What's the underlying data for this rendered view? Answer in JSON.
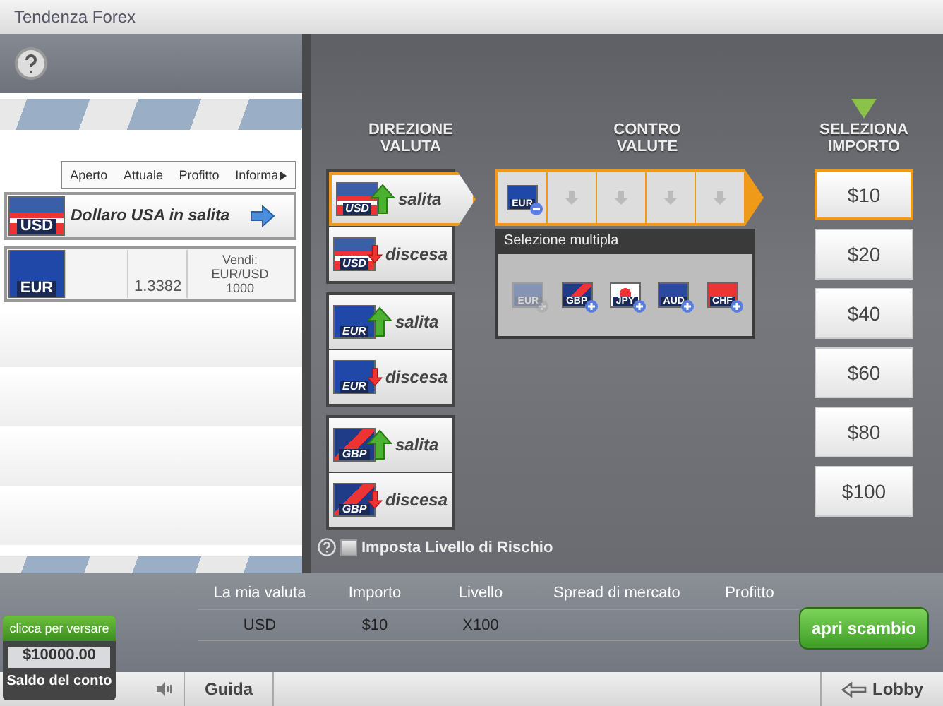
{
  "window": {
    "title": "Tendenza Forex"
  },
  "positions": {
    "columns": [
      "Aperto",
      "Attuale",
      "Profitto",
      "Informa"
    ],
    "banner": {
      "currency": "USD",
      "text": "Dollaro USA in salita"
    },
    "rows": [
      {
        "currency": "EUR",
        "current": "1.3382",
        "info": [
          "Vendi:",
          "EUR/USD",
          "1000"
        ]
      }
    ]
  },
  "direction": {
    "title": "DIREZIONE VALUTA",
    "options": [
      {
        "currency": "USD",
        "kind": "up",
        "label": "salita",
        "selected": true
      },
      {
        "currency": "USD",
        "kind": "down",
        "label": "discesa",
        "selected": false
      },
      {
        "currency": "EUR",
        "kind": "up",
        "label": "salita",
        "selected": false
      },
      {
        "currency": "EUR",
        "kind": "down",
        "label": "discesa",
        "selected": false
      },
      {
        "currency": "GBP",
        "kind": "up",
        "label": "salita",
        "selected": false
      },
      {
        "currency": "GBP",
        "kind": "down",
        "label": "discesa",
        "selected": false
      }
    ]
  },
  "counter": {
    "title": "CONTRO VALUTE",
    "slots": [
      {
        "kind": "currency",
        "currency": "EUR"
      },
      {
        "kind": "empty"
      },
      {
        "kind": "empty"
      },
      {
        "kind": "empty"
      },
      {
        "kind": "empty"
      }
    ],
    "multi": {
      "label": "Selezione multipla",
      "currencies": [
        {
          "code": "EUR",
          "disabled": true
        },
        {
          "code": "GBP",
          "disabled": false
        },
        {
          "code": "JPY",
          "disabled": false
        },
        {
          "code": "AUD",
          "disabled": false
        },
        {
          "code": "CHF",
          "disabled": false
        }
      ]
    }
  },
  "amount": {
    "title": "SELEZIONA IMPORTO",
    "options": [
      {
        "label": "$10",
        "selected": true
      },
      {
        "label": "$20",
        "selected": false
      },
      {
        "label": "$40",
        "selected": false
      },
      {
        "label": "$60",
        "selected": false
      },
      {
        "label": "$80",
        "selected": false
      },
      {
        "label": "$100",
        "selected": false
      }
    ]
  },
  "risk": {
    "label": "Imposta Livello di Rischio",
    "checked": false
  },
  "summary": {
    "columns": [
      "La mia valuta",
      "Importo",
      "Livello",
      "Spread di mercato",
      "Profitto"
    ],
    "row": [
      "USD",
      "$10",
      "X100"
    ]
  },
  "deposit": {
    "button": "clicca per versare",
    "balance": "$10000.00",
    "label": "Saldo del conto"
  },
  "open_button": "apri scambio",
  "footer": {
    "help": "Guida",
    "lobby": "Lobby"
  }
}
